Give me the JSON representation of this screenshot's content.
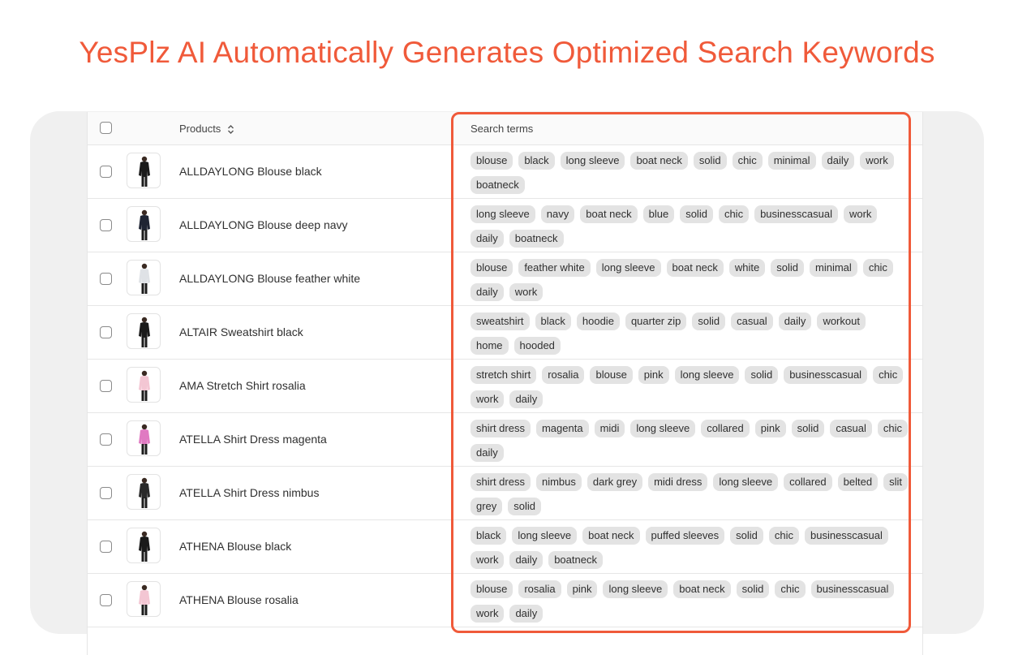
{
  "headline": "YesPlz AI Automatically Generates Optimized Search Keywords",
  "colors": {
    "accent": "#f05a3a",
    "tag_bg": "#e3e3e3",
    "backdrop": "#f0f0f0"
  },
  "table": {
    "columns": {
      "products": "Products",
      "search_terms": "Search terms"
    },
    "rows": [
      {
        "name": "ALLDAYLONG Blouse black",
        "garment": "#1a1a1a",
        "tags": [
          "blouse",
          "black",
          "long sleeve",
          "boat neck",
          "solid",
          "chic",
          "minimal",
          "daily",
          "work",
          "boatneck"
        ]
      },
      {
        "name": "ALLDAYLONG Blouse deep navy",
        "garment": "#1e2433",
        "tags": [
          "long sleeve",
          "navy",
          "boat neck",
          "blue",
          "solid",
          "chic",
          "businesscasual",
          "work",
          "daily",
          "boatneck"
        ]
      },
      {
        "name": "ALLDAYLONG Blouse feather white",
        "garment": "#dfe2e6",
        "tags": [
          "blouse",
          "feather white",
          "long sleeve",
          "boat neck",
          "white",
          "solid",
          "minimal",
          "chic",
          "daily",
          "work"
        ]
      },
      {
        "name": "ALTAIR Sweatshirt black",
        "garment": "#1a1a1a",
        "tags": [
          "sweatshirt",
          "black",
          "hoodie",
          "quarter zip",
          "solid",
          "casual",
          "daily",
          "workout",
          "home",
          "hooded"
        ]
      },
      {
        "name": "AMA Stretch Shirt rosalia",
        "garment": "#f3c6d3",
        "tags": [
          "stretch shirt",
          "rosalia",
          "blouse",
          "pink",
          "long sleeve",
          "solid",
          "businesscasual",
          "chic",
          "work",
          "daily"
        ]
      },
      {
        "name": "ATELLA Shirt Dress magenta",
        "garment": "#e07ac2",
        "tags": [
          "shirt dress",
          "magenta",
          "midi",
          "long sleeve",
          "collared",
          "pink",
          "solid",
          "casual",
          "chic",
          "daily"
        ]
      },
      {
        "name": "ATELLA Shirt Dress nimbus",
        "garment": "#2a2a2a",
        "tags": [
          "shirt dress",
          "nimbus",
          "dark grey",
          "midi dress",
          "long sleeve",
          "collared",
          "belted",
          "slit",
          "grey",
          "solid"
        ]
      },
      {
        "name": "ATHENA Blouse black",
        "garment": "#1a1a1a",
        "tags": [
          "black",
          "long sleeve",
          "boat neck",
          "puffed sleeves",
          "solid",
          "chic",
          "businesscasual",
          "work",
          "daily",
          "boatneck"
        ]
      },
      {
        "name": "ATHENA Blouse rosalia",
        "garment": "#f3c6d3",
        "tags": [
          "blouse",
          "rosalia",
          "pink",
          "long sleeve",
          "boat neck",
          "solid",
          "chic",
          "businesscasual",
          "work",
          "daily"
        ]
      }
    ]
  }
}
